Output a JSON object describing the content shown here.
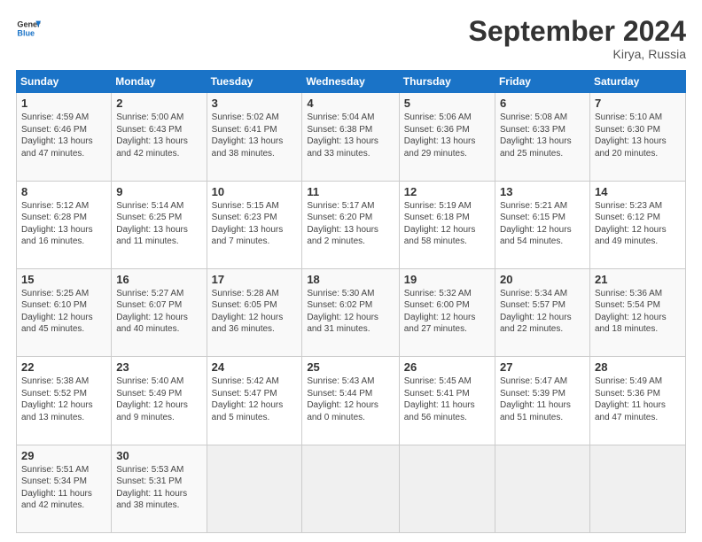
{
  "logo": {
    "line1": "General",
    "line2": "Blue"
  },
  "title": "September 2024",
  "location": "Kirya, Russia",
  "days_header": [
    "Sunday",
    "Monday",
    "Tuesday",
    "Wednesday",
    "Thursday",
    "Friday",
    "Saturday"
  ],
  "weeks": [
    [
      {
        "day": "1",
        "info": "Sunrise: 4:59 AM\nSunset: 6:46 PM\nDaylight: 13 hours\nand 47 minutes."
      },
      {
        "day": "2",
        "info": "Sunrise: 5:00 AM\nSunset: 6:43 PM\nDaylight: 13 hours\nand 42 minutes."
      },
      {
        "day": "3",
        "info": "Sunrise: 5:02 AM\nSunset: 6:41 PM\nDaylight: 13 hours\nand 38 minutes."
      },
      {
        "day": "4",
        "info": "Sunrise: 5:04 AM\nSunset: 6:38 PM\nDaylight: 13 hours\nand 33 minutes."
      },
      {
        "day": "5",
        "info": "Sunrise: 5:06 AM\nSunset: 6:36 PM\nDaylight: 13 hours\nand 29 minutes."
      },
      {
        "day": "6",
        "info": "Sunrise: 5:08 AM\nSunset: 6:33 PM\nDaylight: 13 hours\nand 25 minutes."
      },
      {
        "day": "7",
        "info": "Sunrise: 5:10 AM\nSunset: 6:30 PM\nDaylight: 13 hours\nand 20 minutes."
      }
    ],
    [
      {
        "day": "8",
        "info": "Sunrise: 5:12 AM\nSunset: 6:28 PM\nDaylight: 13 hours\nand 16 minutes."
      },
      {
        "day": "9",
        "info": "Sunrise: 5:14 AM\nSunset: 6:25 PM\nDaylight: 13 hours\nand 11 minutes."
      },
      {
        "day": "10",
        "info": "Sunrise: 5:15 AM\nSunset: 6:23 PM\nDaylight: 13 hours\nand 7 minutes."
      },
      {
        "day": "11",
        "info": "Sunrise: 5:17 AM\nSunset: 6:20 PM\nDaylight: 13 hours\nand 2 minutes."
      },
      {
        "day": "12",
        "info": "Sunrise: 5:19 AM\nSunset: 6:18 PM\nDaylight: 12 hours\nand 58 minutes."
      },
      {
        "day": "13",
        "info": "Sunrise: 5:21 AM\nSunset: 6:15 PM\nDaylight: 12 hours\nand 54 minutes."
      },
      {
        "day": "14",
        "info": "Sunrise: 5:23 AM\nSunset: 6:12 PM\nDaylight: 12 hours\nand 49 minutes."
      }
    ],
    [
      {
        "day": "15",
        "info": "Sunrise: 5:25 AM\nSunset: 6:10 PM\nDaylight: 12 hours\nand 45 minutes."
      },
      {
        "day": "16",
        "info": "Sunrise: 5:27 AM\nSunset: 6:07 PM\nDaylight: 12 hours\nand 40 minutes."
      },
      {
        "day": "17",
        "info": "Sunrise: 5:28 AM\nSunset: 6:05 PM\nDaylight: 12 hours\nand 36 minutes."
      },
      {
        "day": "18",
        "info": "Sunrise: 5:30 AM\nSunset: 6:02 PM\nDaylight: 12 hours\nand 31 minutes."
      },
      {
        "day": "19",
        "info": "Sunrise: 5:32 AM\nSunset: 6:00 PM\nDaylight: 12 hours\nand 27 minutes."
      },
      {
        "day": "20",
        "info": "Sunrise: 5:34 AM\nSunset: 5:57 PM\nDaylight: 12 hours\nand 22 minutes."
      },
      {
        "day": "21",
        "info": "Sunrise: 5:36 AM\nSunset: 5:54 PM\nDaylight: 12 hours\nand 18 minutes."
      }
    ],
    [
      {
        "day": "22",
        "info": "Sunrise: 5:38 AM\nSunset: 5:52 PM\nDaylight: 12 hours\nand 13 minutes."
      },
      {
        "day": "23",
        "info": "Sunrise: 5:40 AM\nSunset: 5:49 PM\nDaylight: 12 hours\nand 9 minutes."
      },
      {
        "day": "24",
        "info": "Sunrise: 5:42 AM\nSunset: 5:47 PM\nDaylight: 12 hours\nand 5 minutes."
      },
      {
        "day": "25",
        "info": "Sunrise: 5:43 AM\nSunset: 5:44 PM\nDaylight: 12 hours\nand 0 minutes."
      },
      {
        "day": "26",
        "info": "Sunrise: 5:45 AM\nSunset: 5:41 PM\nDaylight: 11 hours\nand 56 minutes."
      },
      {
        "day": "27",
        "info": "Sunrise: 5:47 AM\nSunset: 5:39 PM\nDaylight: 11 hours\nand 51 minutes."
      },
      {
        "day": "28",
        "info": "Sunrise: 5:49 AM\nSunset: 5:36 PM\nDaylight: 11 hours\nand 47 minutes."
      }
    ],
    [
      {
        "day": "29",
        "info": "Sunrise: 5:51 AM\nSunset: 5:34 PM\nDaylight: 11 hours\nand 42 minutes."
      },
      {
        "day": "30",
        "info": "Sunrise: 5:53 AM\nSunset: 5:31 PM\nDaylight: 11 hours\nand 38 minutes."
      },
      {
        "day": "",
        "info": ""
      },
      {
        "day": "",
        "info": ""
      },
      {
        "day": "",
        "info": ""
      },
      {
        "day": "",
        "info": ""
      },
      {
        "day": "",
        "info": ""
      }
    ]
  ]
}
